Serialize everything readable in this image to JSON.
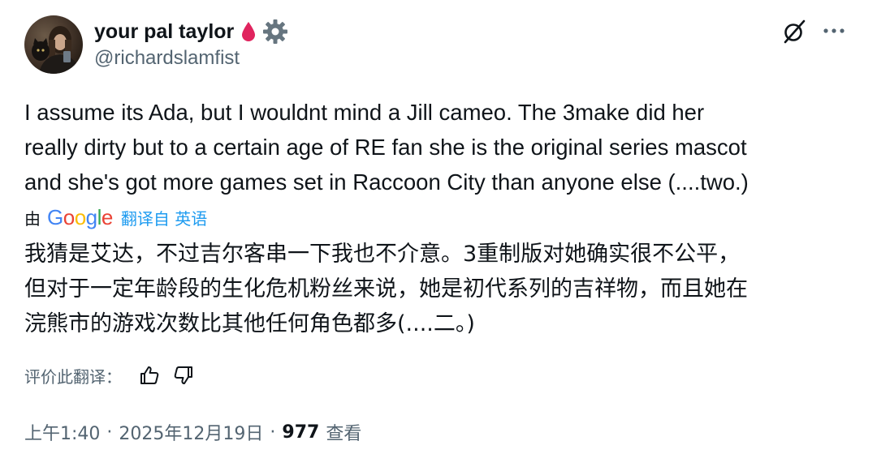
{
  "author": {
    "display_name": "your pal taylor",
    "handle": "@richardslamfist",
    "avatar_icon": "avatar-photo",
    "badge_icons": [
      "blood-drop-icon",
      "gear-icon"
    ]
  },
  "header_actions": {
    "grok_icon": "grok-icon",
    "more_icon": "more-icon"
  },
  "tweet": {
    "text": "I assume its Ada, but I wouldnt mind a Jill cameo. The 3make did her\nreally dirty but to a certain age of RE fan she is the original series mascot\nand she's got more games set in Raccoon City than anyone else (....two.)"
  },
  "translation": {
    "by_label": "由",
    "provider": "Google",
    "from_label": "翻译自 英语",
    "text": "我猜是艾达，不过吉尔客串一下我也不介意。3重制版对她确实很不公平，\n但对于一定年龄段的生化危机粉丝来说，她是初代系列的吉祥物，而且她在\n浣熊市的游戏次数比其他任何角色都多(....二。)",
    "rate_label": "评价此翻译："
  },
  "meta": {
    "time": "上午1:40",
    "date": "2025年12月19日",
    "separator": "·",
    "views": "977",
    "views_label": "查看"
  },
  "colors": {
    "text_primary": "#0f1419",
    "text_secondary": "#536471",
    "link_blue": "#1d9bf0",
    "blood_red": "#e0245e"
  }
}
